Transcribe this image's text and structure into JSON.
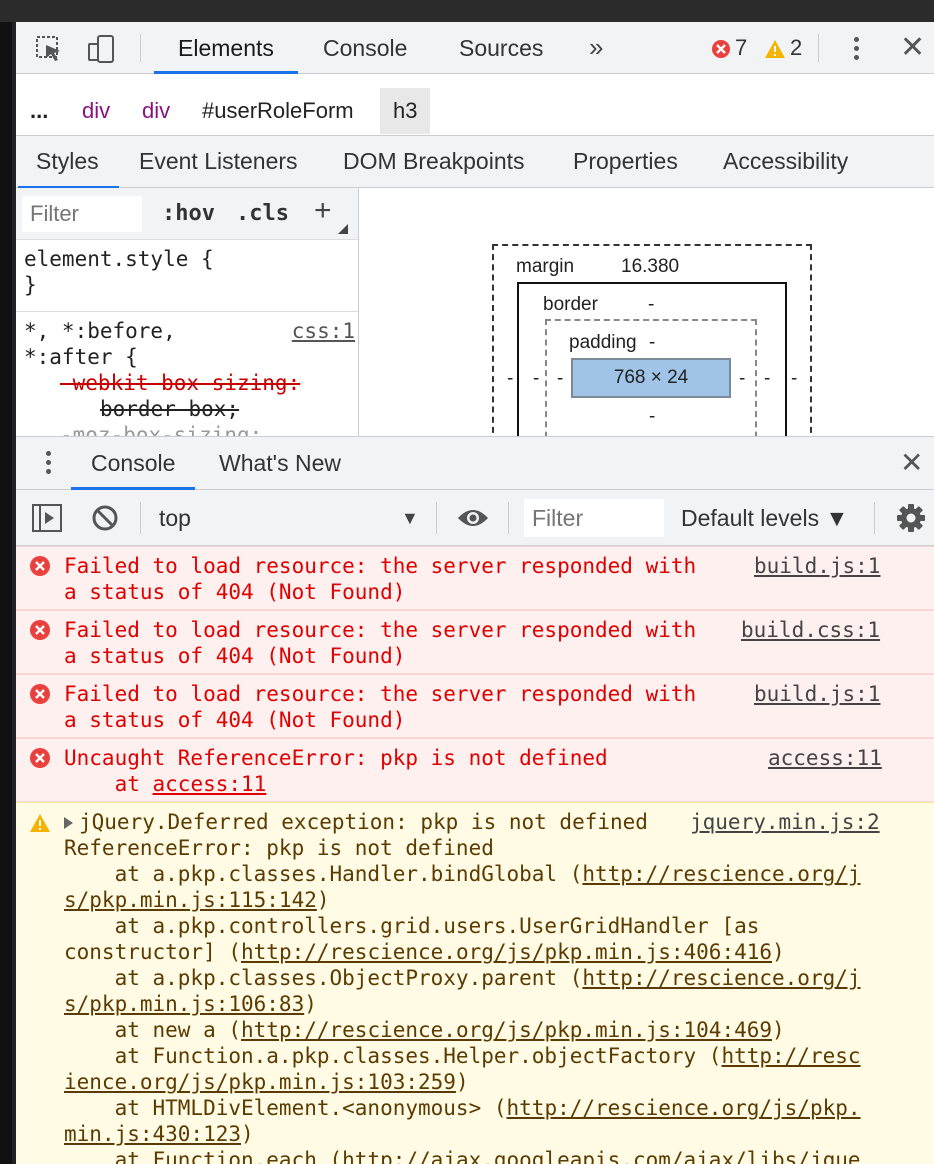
{
  "toolbar": {
    "tabs": [
      "Elements",
      "Console",
      "Sources"
    ],
    "more": "»",
    "error_count": "7",
    "warning_count": "2",
    "close": "✕"
  },
  "breadcrumb": {
    "dots": "...",
    "items": [
      "div",
      "div",
      "#userRoleForm",
      "h3"
    ]
  },
  "subtabs": [
    "Styles",
    "Event Listeners",
    "DOM Breakpoints",
    "Properties",
    "Accessibility"
  ],
  "styles": {
    "filter_placeholder": "Filter",
    "hov": ":hov",
    "cls": ".cls",
    "plus": "+",
    "element_style_open": "element.style {",
    "element_style_close": "}",
    "rule2_sel1": "*, *:before,",
    "rule2_sel2": "*:after {",
    "rule2_src": "css:1",
    "rule2_prop1": "-webkit-box-sizing:",
    "rule2_val1": "border-box;",
    "rule2_prop2": "-moz-box-sizing:"
  },
  "boxmodel": {
    "margin_label": "margin",
    "margin_value": "16.380",
    "border_label": "border",
    "border_value": "-",
    "padding_label": "padding",
    "padding_value": "-",
    "content": "768 × 24",
    "dash": "-"
  },
  "drawer": {
    "tabs": [
      "Console",
      "What's New"
    ],
    "close": "✕"
  },
  "console_toolbar": {
    "context": "top",
    "filter_placeholder": "Filter",
    "levels": "Default levels ▼"
  },
  "messages": [
    {
      "type": "error",
      "line1": "Failed to load resource: the server responded with",
      "line2": "a status of 404 (Not Found)",
      "source": "build.js:1"
    },
    {
      "type": "error",
      "line1": "Failed to load resource: the server responded with",
      "line2": "a status of 404 (Not Found)",
      "source": "build.css:1"
    },
    {
      "type": "error",
      "line1": "Failed to load resource: the server responded with",
      "line2": "a status of 404 (Not Found)",
      "source": "build.js:1"
    },
    {
      "type": "error",
      "line1": "Uncaught ReferenceError: pkp is not defined",
      "line2_prefix": "    at ",
      "line2_link": "access:11",
      "source": "access:11"
    }
  ],
  "warning": {
    "head": "jQuery.Deferred exception: pkp is not defined",
    "source": "jquery.min.js:2",
    "lines": [
      {
        "pre": "ReferenceError: pkp is not defined",
        "link": "",
        "post": ""
      },
      {
        "pre": "    at a.pkp.classes.Handler.bindGlobal (",
        "link": "http://rescience.org/j",
        "post": ""
      },
      {
        "pre": "",
        "link": "s/pkp.min.js:115:142",
        "post": ")"
      },
      {
        "pre": "    at a.pkp.controllers.grid.users.UserGridHandler [as",
        "link": "",
        "post": ""
      },
      {
        "pre": "constructor] (",
        "link": "http://rescience.org/js/pkp.min.js:406:416",
        "post": ")"
      },
      {
        "pre": "    at a.pkp.classes.ObjectProxy.parent (",
        "link": "http://rescience.org/j",
        "post": ""
      },
      {
        "pre": "",
        "link": "s/pkp.min.js:106:83",
        "post": ")"
      },
      {
        "pre": "    at new a (",
        "link": "http://rescience.org/js/pkp.min.js:104:469",
        "post": ")"
      },
      {
        "pre": "    at Function.a.pkp.classes.Helper.objectFactory (",
        "link": "http://resc",
        "post": ""
      },
      {
        "pre": "",
        "link": "ience.org/js/pkp.min.js:103:259",
        "post": ")"
      },
      {
        "pre": "    at HTMLDivElement.<anonymous> (",
        "link": "http://rescience.org/js/pkp.",
        "post": ""
      },
      {
        "pre": "",
        "link": "min.js:430:123",
        "post": ")"
      },
      {
        "pre": "    at Function.each (",
        "link": "http://ajax.googleapis.com/ajax/libs/jque",
        "post": ""
      }
    ]
  },
  "colors": {
    "accent": "#1a73e8",
    "error_text": "#e00000",
    "error_bg": "#fff0f0",
    "warning_bg": "#fffbe5",
    "tag_purple": "#881280"
  }
}
